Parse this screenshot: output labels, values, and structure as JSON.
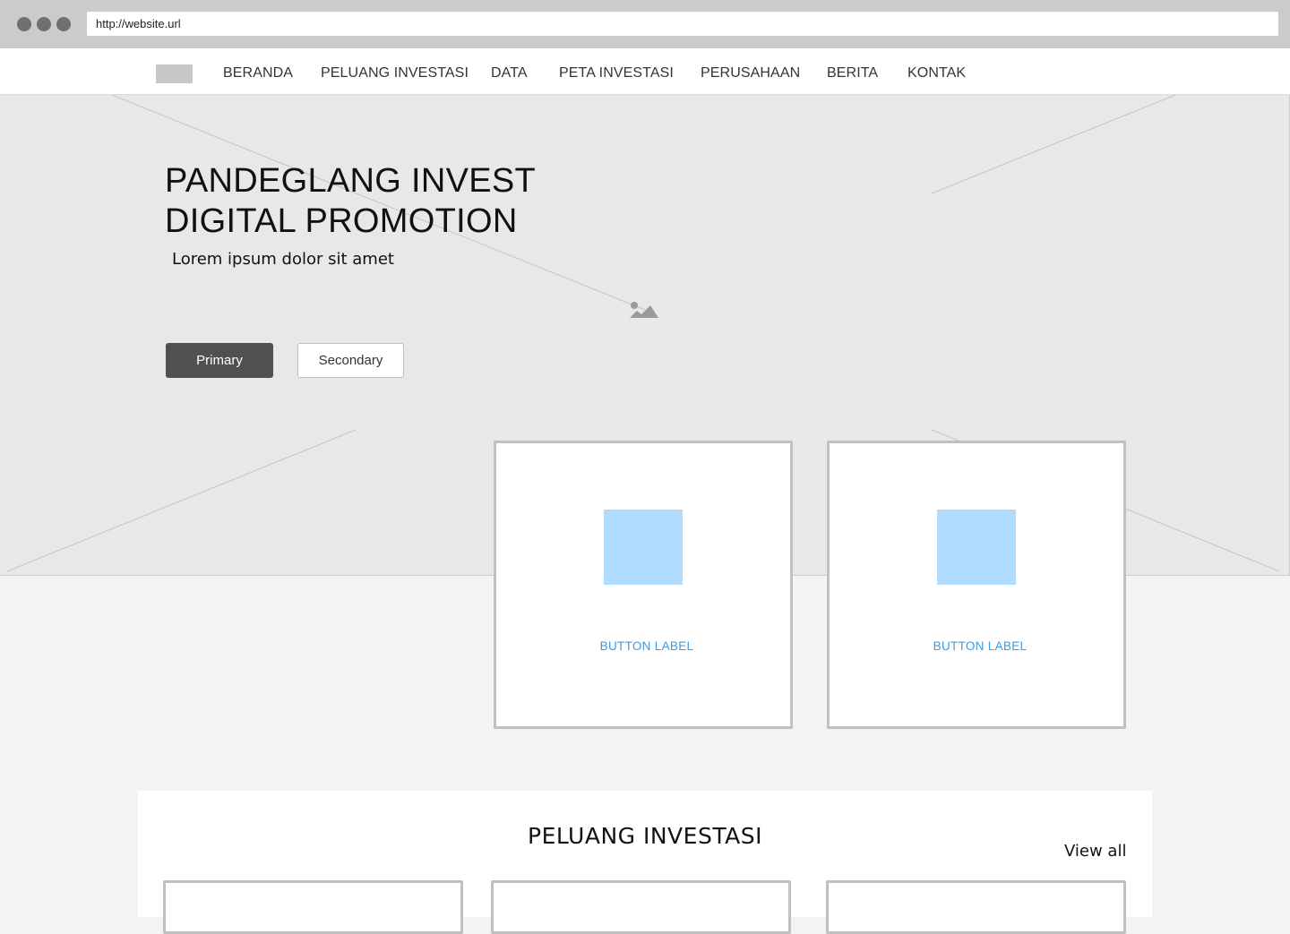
{
  "browser": {
    "url": "http://website.url",
    "dots": [
      "window-dot",
      "window-dot",
      "window-dot"
    ]
  },
  "navbar": {
    "items": [
      {
        "label": "BERANDA"
      },
      {
        "label": "PELUANG INVESTASI"
      },
      {
        "label": "DATA"
      },
      {
        "label": "PETA INVESTASI"
      },
      {
        "label": "PERUSAHAAN"
      },
      {
        "label": "BERITA"
      },
      {
        "label": "KONTAK"
      }
    ]
  },
  "hero": {
    "title_line1": "PANDEGLANG INVEST",
    "title_line2": "DIGITAL PROMOTION",
    "subtitle": "Lorem ipsum dolor sit amet",
    "primary_label": "Primary",
    "secondary_label": "Secondary",
    "placeholder_icon": "image-placeholder-icon"
  },
  "cards": [
    {
      "button_label": "BUTTON LABEL"
    },
    {
      "button_label": "BUTTON LABEL"
    }
  ],
  "section": {
    "title": "PELUANG INVESTASI",
    "view_all": "View all"
  },
  "colors": {
    "hero_bg": "#e8e8e8",
    "primary_btn": "#505050",
    "card_link": "#3a9be0",
    "thumb": "#b0dcff"
  }
}
